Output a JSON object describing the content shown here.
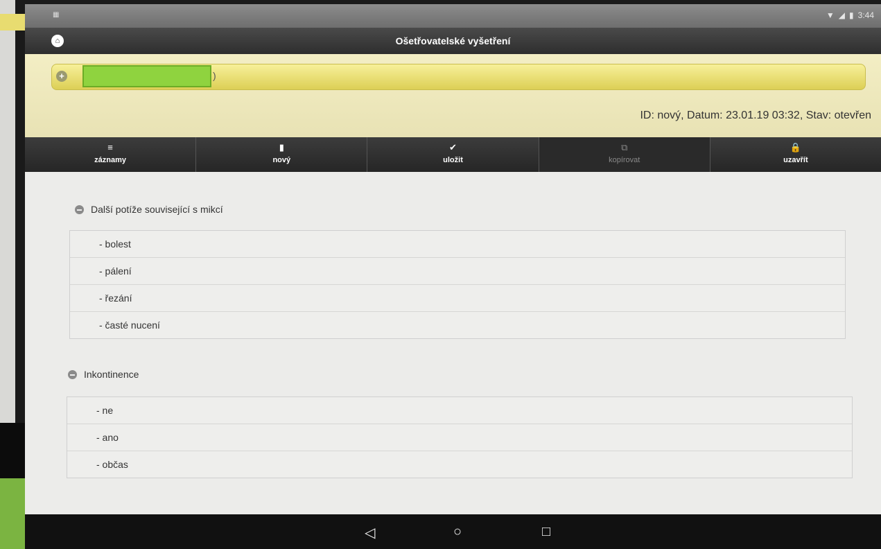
{
  "status_bar": {
    "time": "3:44"
  },
  "title_bar": {
    "title": "Ošetřovatelské vyšetření"
  },
  "patient": {
    "meta": "ID: nový, Datum: 23.01.19 03:32, Stav: otevřen"
  },
  "toolbar": {
    "items": [
      {
        "label": "záznamy",
        "icon": "list-icon",
        "glyph": "≡"
      },
      {
        "label": "nový",
        "icon": "new-document-icon",
        "glyph": "▮"
      },
      {
        "label": "uložit",
        "icon": "checkmark-icon",
        "glyph": "✔"
      },
      {
        "label": "kopírovat",
        "icon": "copy-icon",
        "glyph": "⧉",
        "disabled": true
      },
      {
        "label": "uzavřít",
        "icon": "lock-icon",
        "glyph": "🔒"
      }
    ]
  },
  "sections": [
    {
      "title": "Další potíže související s mikcí",
      "options": [
        "- bolest",
        "- pálení",
        "- řezání",
        "- časté nucení"
      ]
    },
    {
      "title": "Inkontinence",
      "options": [
        "- ne",
        "- ano",
        "- občas"
      ]
    }
  ],
  "nav_bar": {
    "back": "◁",
    "home": "○",
    "recents": "□"
  }
}
